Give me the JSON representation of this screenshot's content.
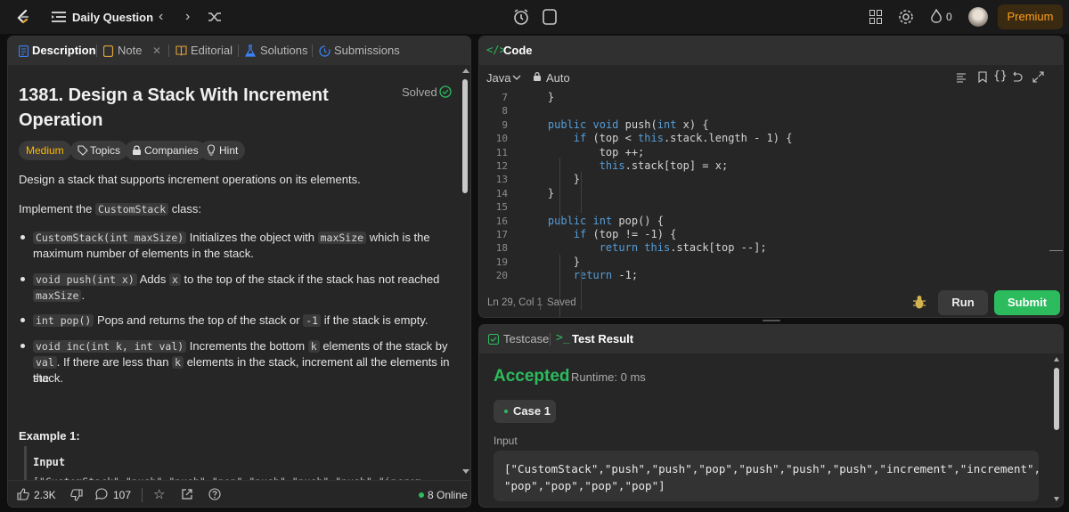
{
  "topbar": {
    "list_title": "Daily Question",
    "premium": "Premium",
    "streak": "0"
  },
  "left_tabs": {
    "description": "Description",
    "note": "Note",
    "editorial": "Editorial",
    "solutions": "Solutions",
    "submissions": "Submissions"
  },
  "problem": {
    "title_line1": "1381. Design a Stack With Increment",
    "title_line2": "Operation",
    "status": "Solved",
    "difficulty": "Medium",
    "tags": {
      "topics": "Topics",
      "companies": "Companies",
      "hint": "Hint"
    },
    "intro": "Design a stack that supports increment operations on its elements.",
    "implement_prefix": "Implement the",
    "implement_code": "CustomStack",
    "implement_suffix": "class:",
    "b1_code": "CustomStack(int maxSize)",
    "b1_text1": "Initializes the object with",
    "b1_code2": "maxSize",
    "b1_text2": "which is the",
    "b1_line2": "maximum number of elements in the stack.",
    "b2_code": "void push(int x)",
    "b2_text1": "Adds",
    "b2_code2": "x",
    "b2_text2": "to the top of the stack if the stack has not reached the",
    "b2_code3": "maxSize",
    "b2_end": ".",
    "b3_code": "int pop()",
    "b3_text1": "Pops and returns the top of the stack or",
    "b3_code2": "-1",
    "b3_text2": "if the stack is empty.",
    "b4_code": "void inc(int k, int val)",
    "b4_text1": "Increments the bottom",
    "b4_code2": "k",
    "b4_text2": "elements of the stack by",
    "b4_code3": "val",
    "b4_text3": ". If there are less than",
    "b4_code4": "k",
    "b4_text4": "elements in the stack, increment all the elements in the",
    "b4_line3": "stack.",
    "example_heading": "Example 1:",
    "input_label": "Input",
    "input_value": "[\"CustomStack\",\"push\",\"push\",\"pop\",\"push\",\"push\",\"push\",\"increm"
  },
  "footer": {
    "likes": "2.3K",
    "comments": "107",
    "online": "8 Online"
  },
  "code_panel": {
    "title": "Code",
    "language": "Java",
    "mode": "Auto",
    "status_pos": "Ln 29, Col 1",
    "status_saved": "Saved",
    "run": "Run",
    "submit": "Submit",
    "lines": [
      {
        "n": "7",
        "text": "    }"
      },
      {
        "n": "8",
        "text": ""
      },
      {
        "n": "9",
        "text": "    public void push(int x) {"
      },
      {
        "n": "10",
        "text": "        if (top < this.stack.length - 1) {"
      },
      {
        "n": "11",
        "text": "            top ++;"
      },
      {
        "n": "12",
        "text": "            this.stack[top] = x;"
      },
      {
        "n": "13",
        "text": "        }"
      },
      {
        "n": "14",
        "text": "    }"
      },
      {
        "n": "15",
        "text": ""
      },
      {
        "n": "16",
        "text": "    public int pop() {"
      },
      {
        "n": "17",
        "text": "        if (top != -1) {"
      },
      {
        "n": "18",
        "text": "            return this.stack[top --];"
      },
      {
        "n": "19",
        "text": "        }"
      },
      {
        "n": "20",
        "text": "        return -1;"
      }
    ]
  },
  "result_panel": {
    "testcase_tab": "Testcase",
    "result_tab": "Test Result",
    "verdict": "Accepted",
    "runtime": "Runtime: 0 ms",
    "case_label": "Case 1",
    "input_label": "Input",
    "input_line1": "[\"CustomStack\",\"push\",\"push\",\"pop\",\"push\",\"push\",\"push\",\"increment\",\"increment\",",
    "input_line2": "\"pop\",\"pop\",\"pop\",\"pop\"]"
  },
  "colors": {
    "accent_green": "#2cbb5d",
    "medium": "#ffb800",
    "premium": "#ffa116"
  }
}
